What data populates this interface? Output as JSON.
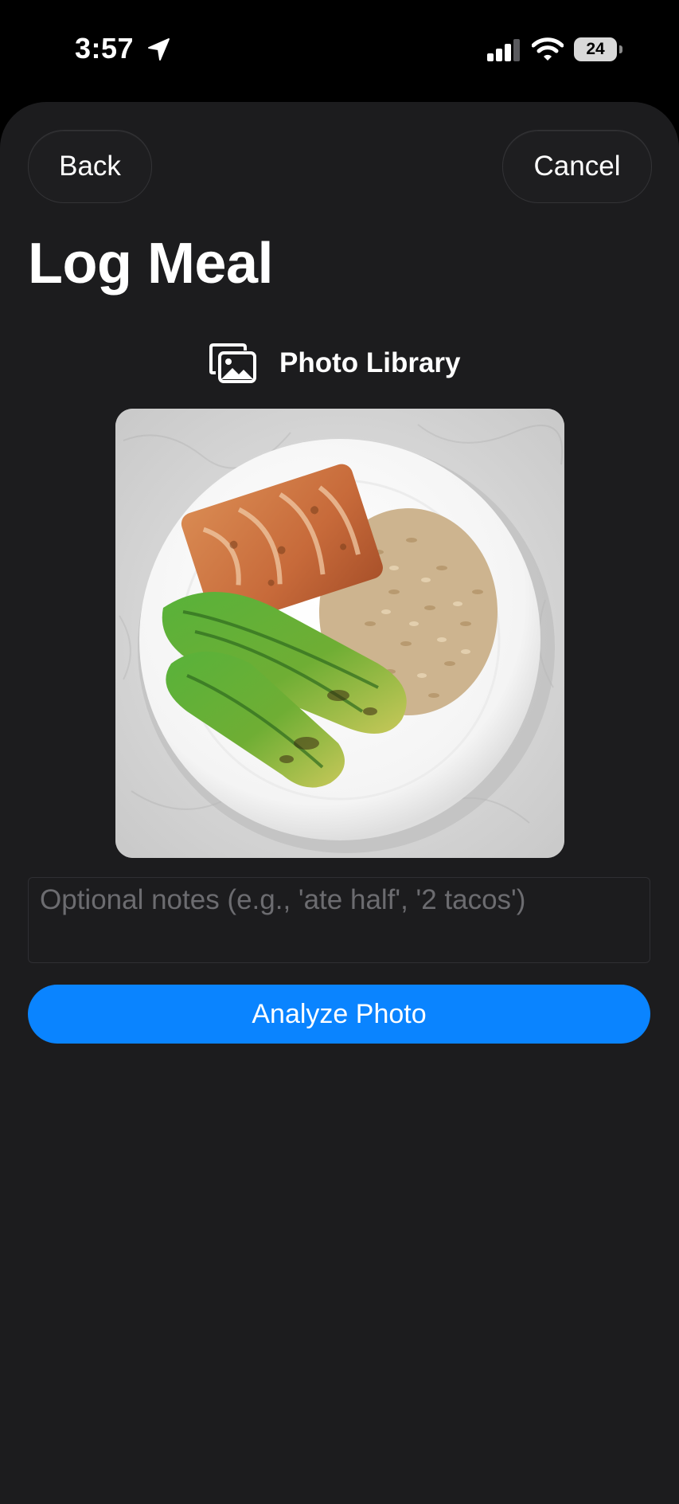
{
  "status_bar": {
    "time": "3:57",
    "battery_level": "24",
    "icons": [
      "location-arrow-icon",
      "cellular-signal-icon",
      "wifi-icon",
      "battery-icon"
    ]
  },
  "header": {
    "back_label": "Back",
    "cancel_label": "Cancel"
  },
  "title": "Log Meal",
  "photo_source": {
    "label": "Photo Library",
    "icon": "photo-library-icon"
  },
  "notes": {
    "value": "",
    "placeholder": "Optional notes (e.g., 'ate half', '2 tacos')"
  },
  "analyze_label": "Analyze Photo",
  "colors": {
    "sheet_background": "#1c1c1e",
    "accent": "#0a84ff",
    "placeholder_text": "#6c6c70"
  }
}
